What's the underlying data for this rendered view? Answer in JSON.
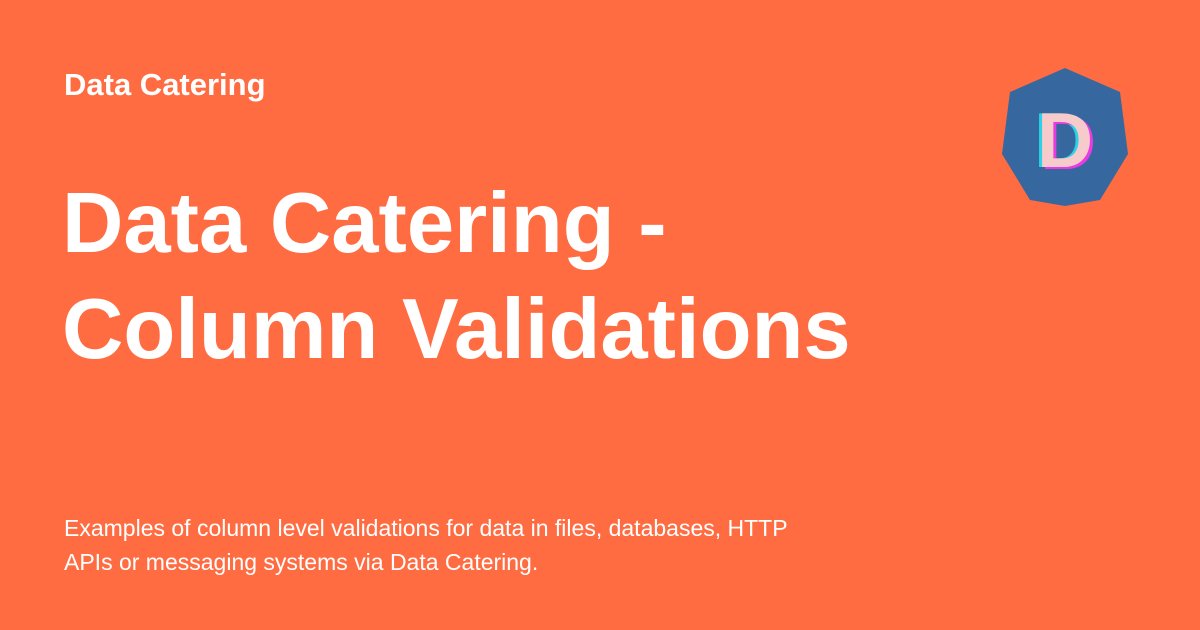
{
  "header": {
    "site_name": "Data Catering"
  },
  "main": {
    "title_lines": [
      "Data Catering -",
      "Column Validations"
    ],
    "description_lines": [
      "Examples of column level validations for data in files, databases, HTTP",
      "APIs or messaging systems via Data Catering."
    ]
  },
  "logo": {
    "letter": "D",
    "hexagon_color": "#36689f",
    "letter_color": "#f7cbcb",
    "shadow_cyan": "#29d3e6",
    "shadow_magenta": "#e83ce0"
  },
  "colors": {
    "background": "#ff6c42",
    "text": "#ffffff"
  }
}
